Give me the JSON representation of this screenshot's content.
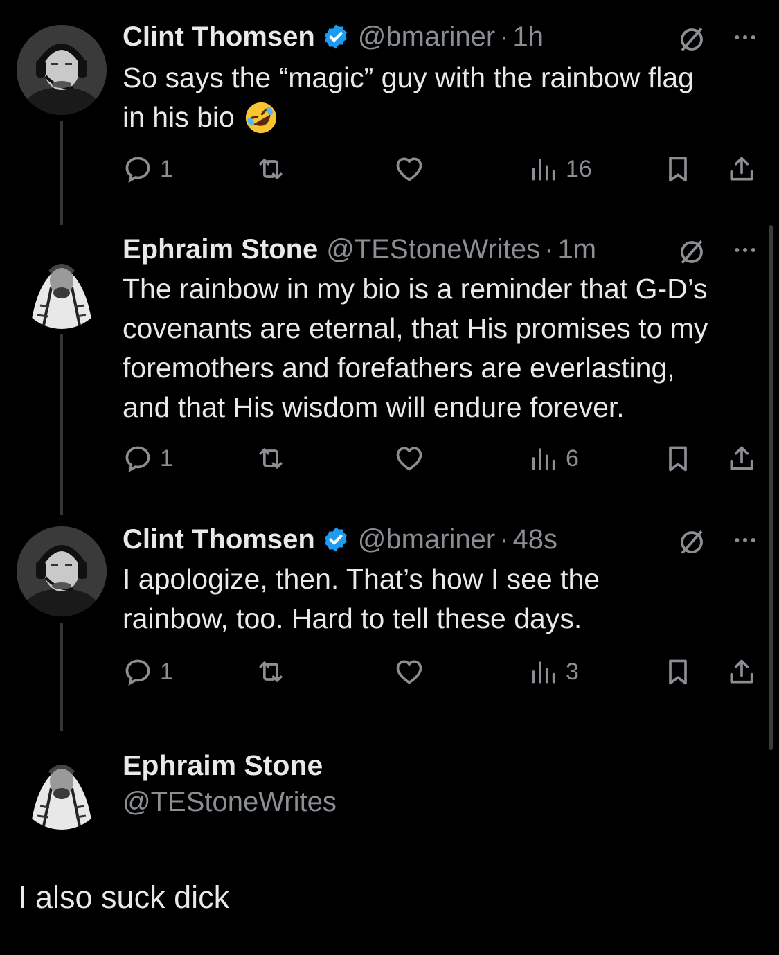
{
  "colors": {
    "background": "#000000",
    "text": "#e7e9ea",
    "muted": "#8b8f94",
    "verified": "#1d9bf0",
    "emoji": "#f7c531"
  },
  "tweets": [
    {
      "author": "Clint Thomsen",
      "verified": true,
      "handle": "@bmariner",
      "time": "1h",
      "lines": [
        "So says the “magic” guy with the rainbow flag",
        "in his bio"
      ],
      "emoji": "rolling-on-the-floor-laughing-emoji",
      "reply_count": "1",
      "view_count": "16"
    },
    {
      "author": "Ephraim Stone",
      "verified": false,
      "handle": "@TEStoneWrites",
      "time": "1m",
      "lines": [
        "The rainbow in my bio is a reminder that G-D’s",
        "covenants are eternal, that His promises to my",
        "foremothers and forefathers are everlasting,",
        "and that His wisdom will endure forever."
      ],
      "reply_count": "1",
      "view_count": "6"
    },
    {
      "author": "Clint Thomsen",
      "verified": true,
      "handle": "@bmariner",
      "time": "48s",
      "lines": [
        "I apologize, then. That’s how I see the",
        "rainbow, too. Hard to tell these days."
      ],
      "reply_count": "1",
      "view_count": "3"
    }
  ],
  "separator": "·",
  "profile": {
    "name": "Ephraim Stone",
    "handle": "@TEStoneWrites",
    "bio": "I also suck dick"
  },
  "icons": [
    "grok-icon",
    "more-icon",
    "reply-icon",
    "retweet-icon",
    "like-icon",
    "views-icon",
    "bookmark-icon",
    "share-icon",
    "verified-badge-icon"
  ]
}
